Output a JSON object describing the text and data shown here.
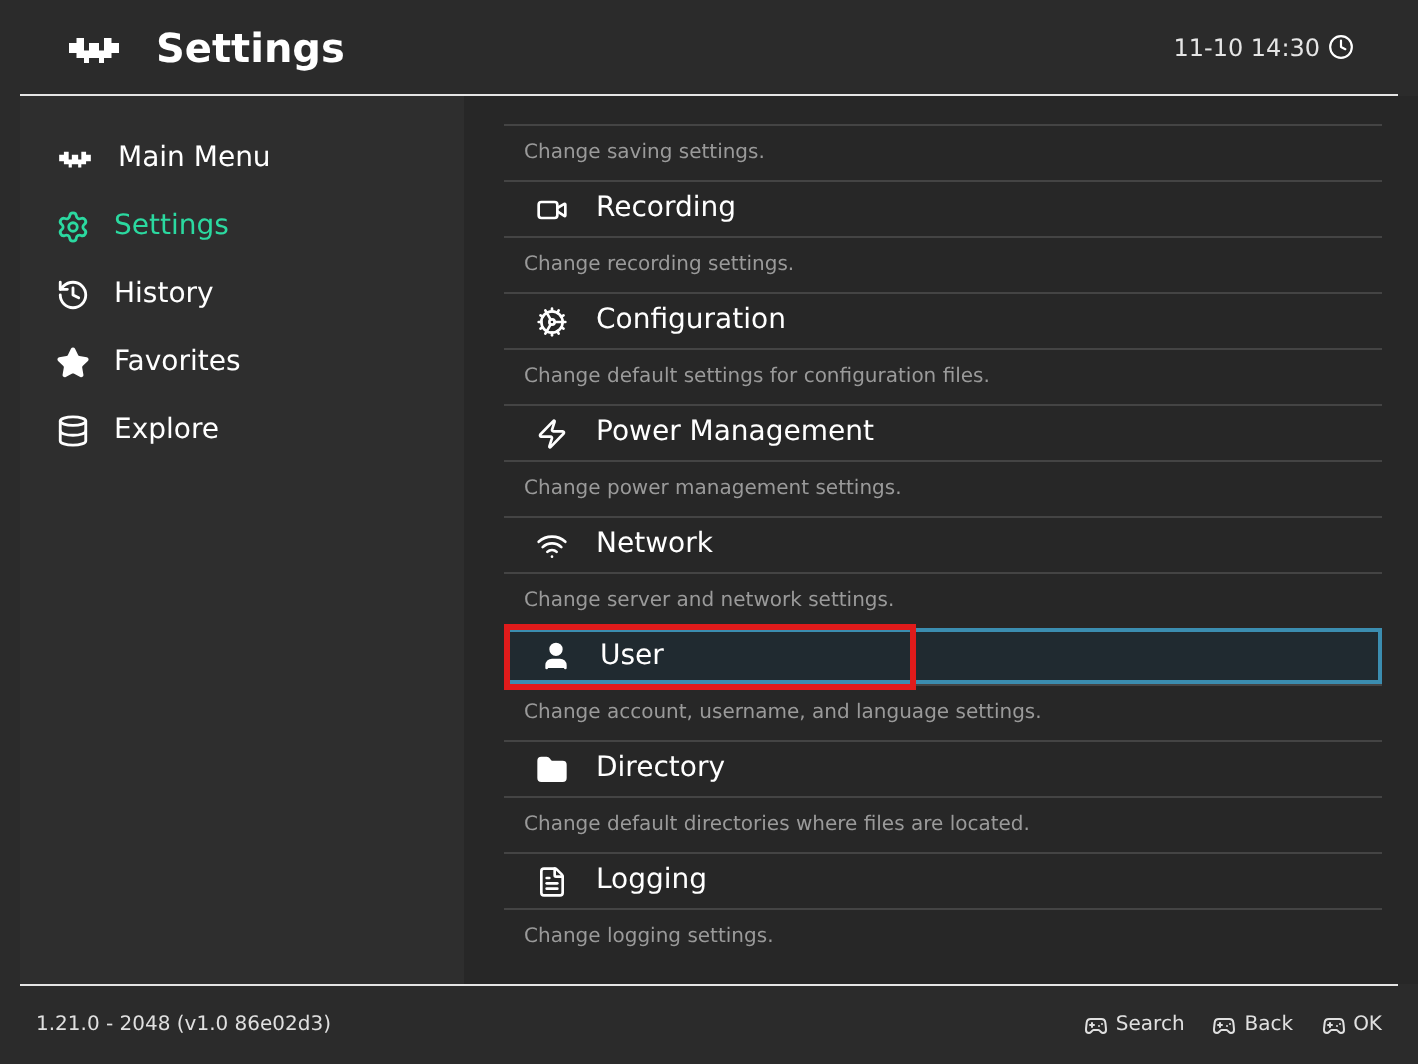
{
  "header": {
    "title": "Settings",
    "clock": "11-10 14:30"
  },
  "sidebar": {
    "items": [
      {
        "label": "Main Menu",
        "selected": false
      },
      {
        "label": "Settings",
        "selected": true
      },
      {
        "label": "History",
        "selected": false
      },
      {
        "label": "Favorites",
        "selected": false
      },
      {
        "label": "Explore",
        "selected": false
      }
    ]
  },
  "settings_list": {
    "partial_first_description": "Change saving settings.",
    "items": [
      {
        "title": "Recording",
        "description": "Change recording settings.",
        "selected": false,
        "annotated": false
      },
      {
        "title": "Configuration",
        "description": "Change default settings for configuration files.",
        "selected": false,
        "annotated": false
      },
      {
        "title": "Power Management",
        "description": "Change power management settings.",
        "selected": false,
        "annotated": false
      },
      {
        "title": "Network",
        "description": "Change server and network settings.",
        "selected": false,
        "annotated": false
      },
      {
        "title": "User",
        "description": "Change account, username, and language settings.",
        "selected": true,
        "annotated": true
      },
      {
        "title": "Directory",
        "description": "Change default directories where files are located.",
        "selected": false,
        "annotated": false
      },
      {
        "title": "Logging",
        "description": "Change logging settings.",
        "selected": false,
        "annotated": false
      }
    ]
  },
  "footer": {
    "version": "1.21.0 - 2048 (v1.0 86e02d3)",
    "actions": [
      "Search",
      "Back",
      "OK"
    ]
  }
}
